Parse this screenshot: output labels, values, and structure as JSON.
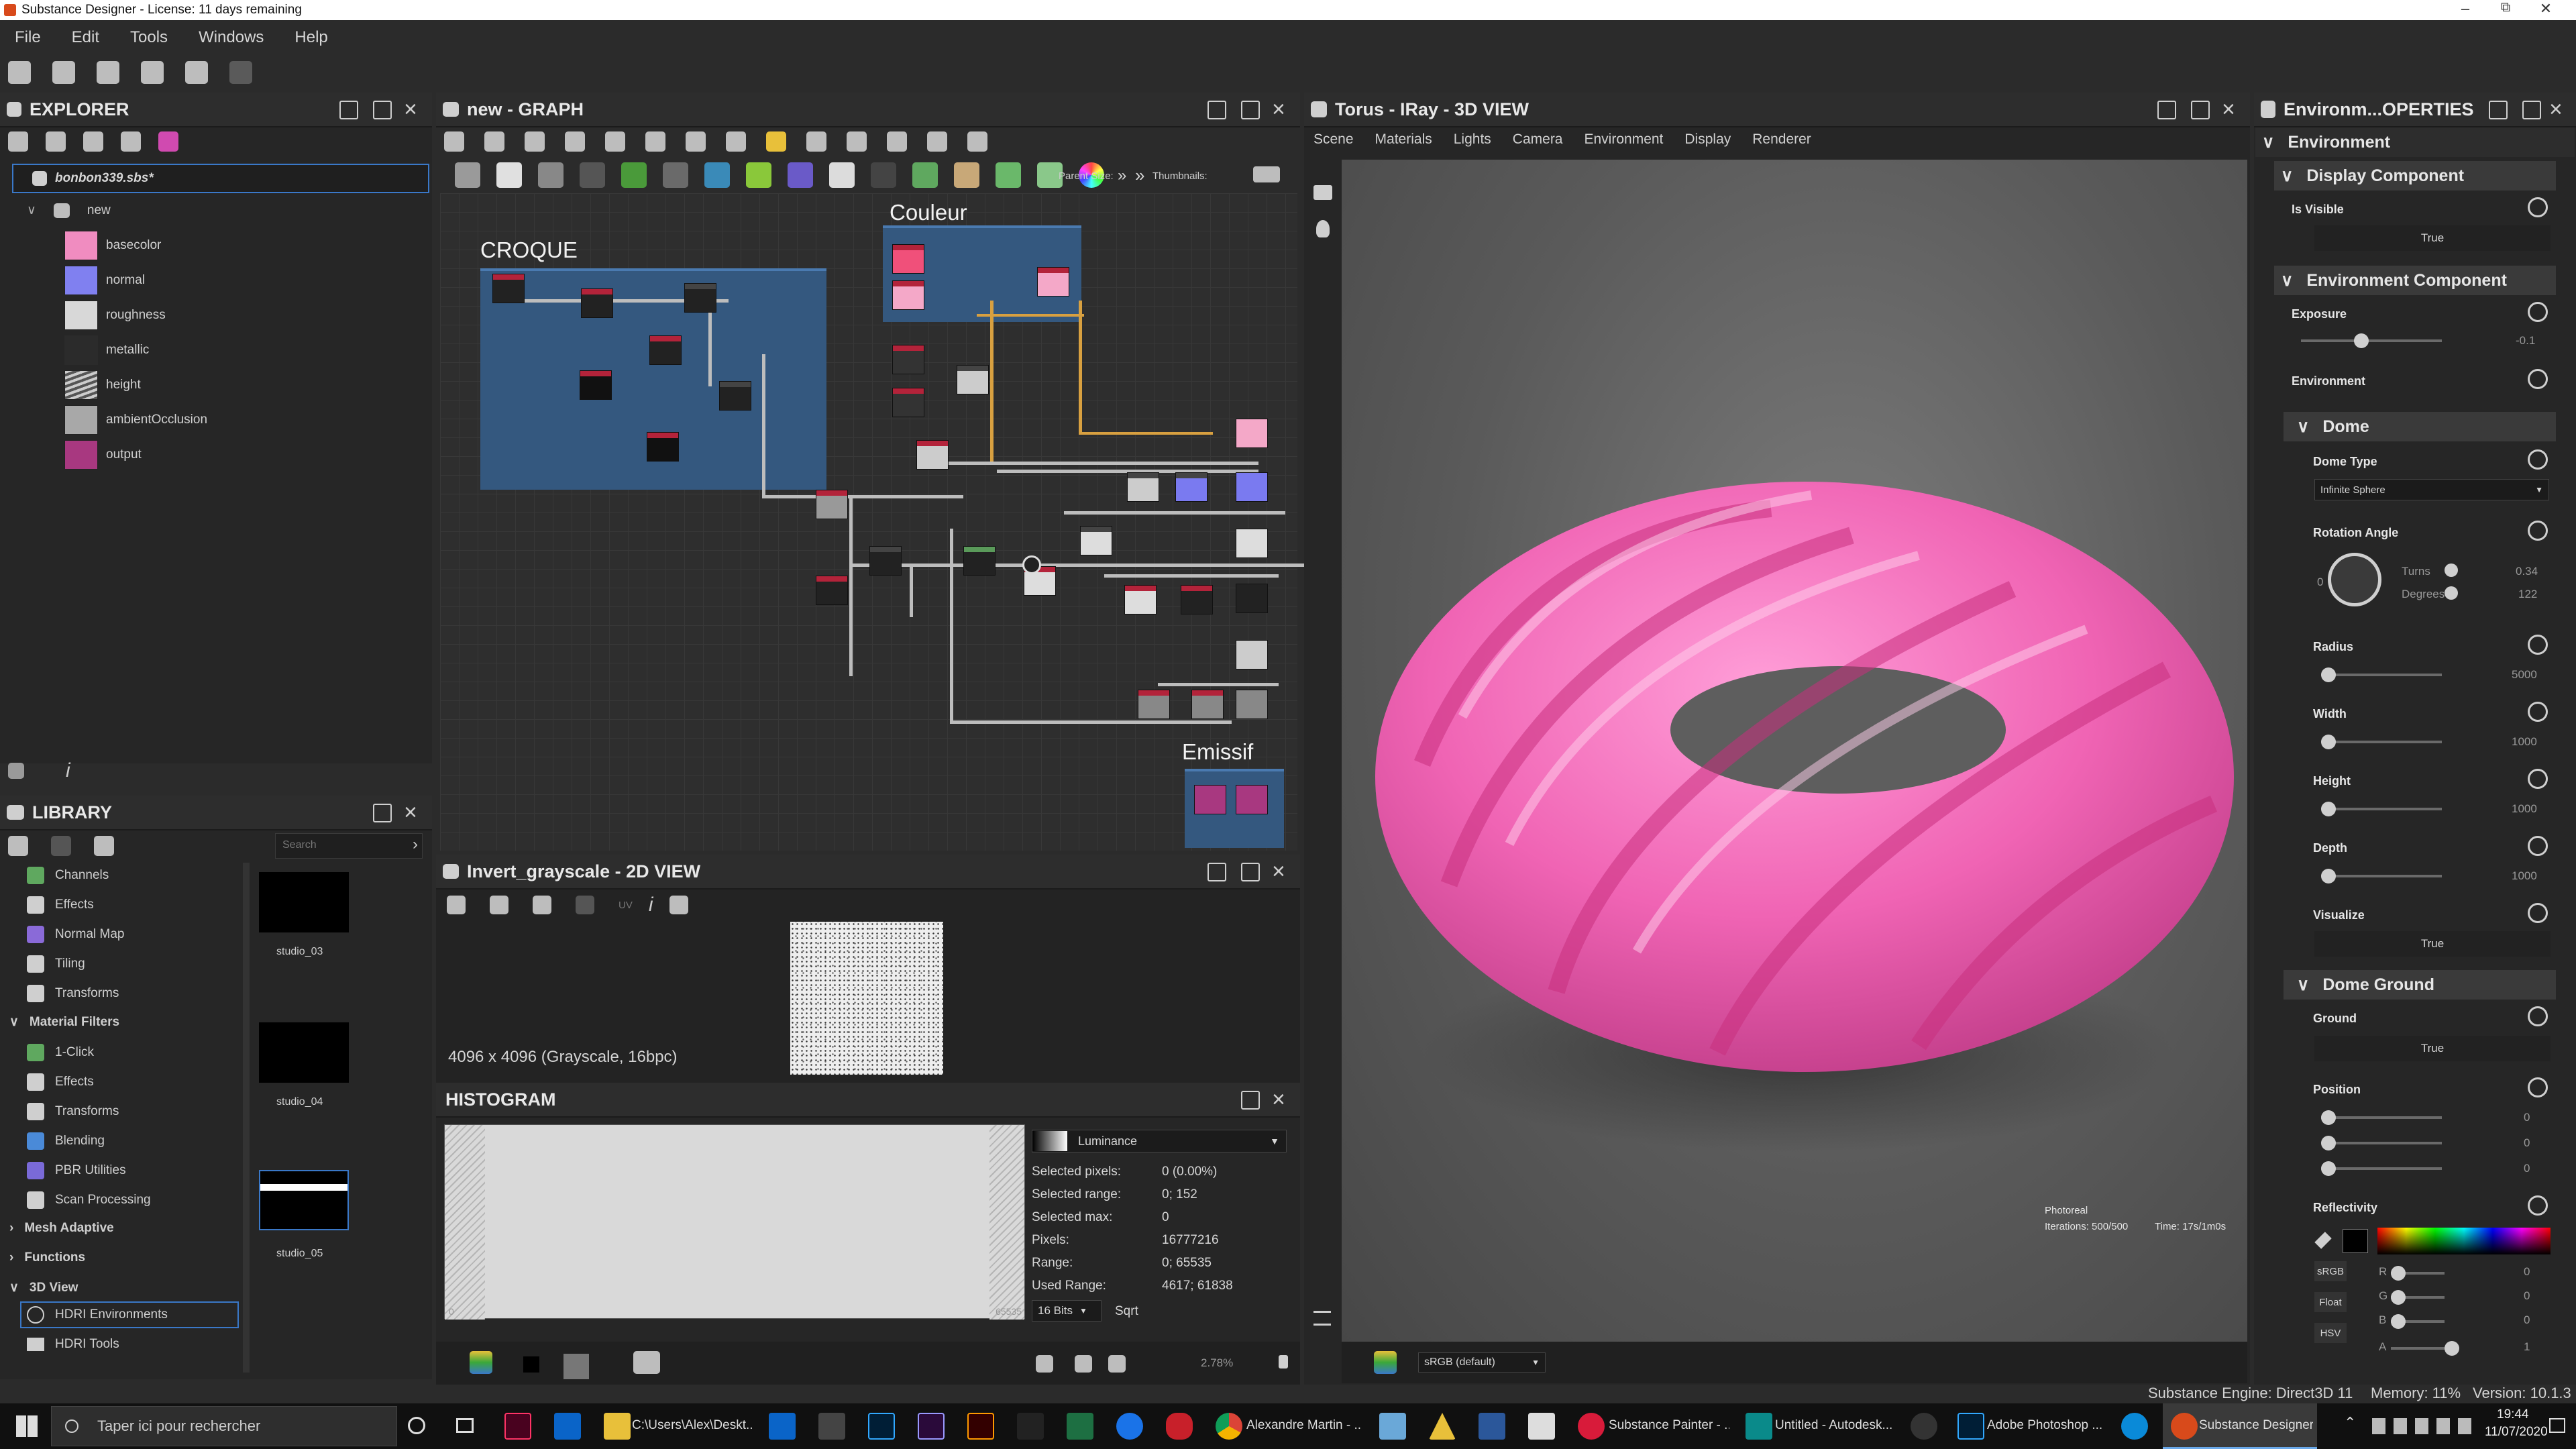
{
  "window": {
    "title": "Substance Designer - License: 11 days remaining"
  },
  "menu": [
    "File",
    "Edit",
    "Tools",
    "Windows",
    "Help"
  ],
  "explorer": {
    "title": "EXPLORER",
    "file": "bonbon339.sbs*",
    "graph": "new",
    "items": [
      {
        "label": "basecolor",
        "color": "#f08cc0"
      },
      {
        "label": "normal",
        "color": "#8080f0"
      },
      {
        "label": "roughness",
        "color": "#d8d8d8"
      },
      {
        "label": "metallic",
        "color": "#2b2b2b"
      },
      {
        "label": "height",
        "color": "#9a9a9a"
      },
      {
        "label": "ambientOcclusion",
        "color": "#a8a8a8"
      },
      {
        "label": "output",
        "color": "#a83880"
      }
    ]
  },
  "library": {
    "title": "LIBRARY",
    "search_placeholder": "Search",
    "items": [
      {
        "label": "Channels",
        "type": "item",
        "color": "#5fa85f"
      },
      {
        "label": "Effects",
        "type": "item",
        "color": "#cfcfcf"
      },
      {
        "label": "Normal Map",
        "type": "item",
        "color": "#8a6ad8"
      },
      {
        "label": "Tiling",
        "type": "item",
        "color": "#cfcfcf"
      },
      {
        "label": "Transforms",
        "type": "item",
        "color": "#cfcfcf"
      },
      {
        "label": "Material Filters",
        "type": "section"
      },
      {
        "label": "1-Click",
        "type": "item",
        "color": "#5fa85f"
      },
      {
        "label": "Effects",
        "type": "item",
        "color": "#cfcfcf"
      },
      {
        "label": "Transforms",
        "type": "item",
        "color": "#cfcfcf"
      },
      {
        "label": "Blending",
        "type": "item",
        "color": "#4a8ad8"
      },
      {
        "label": "PBR Utilities",
        "type": "item",
        "color": "#7a6ad8"
      },
      {
        "label": "Scan Processing",
        "type": "item",
        "color": "#cfcfcf"
      },
      {
        "label": "Mesh Adaptive",
        "type": "section-collapsed"
      },
      {
        "label": "Functions",
        "type": "section-collapsed"
      },
      {
        "label": "3D View",
        "type": "section"
      },
      {
        "label": "HDRI Environments",
        "type": "selected"
      },
      {
        "label": "HDRI Tools",
        "type": "item",
        "color": "#cfcfcf"
      }
    ],
    "thumbs": [
      "studio_03",
      "studio_04",
      "studio_05"
    ]
  },
  "graph": {
    "title": "new - GRAPH",
    "parent_size_label": "Parent Size:",
    "thumbnails_label": "Thumbnails:",
    "frames": [
      {
        "label": "CROQUE"
      },
      {
        "label": "Couleur"
      },
      {
        "label": "Emissif"
      }
    ]
  },
  "view2d": {
    "title": "Invert_grayscale - 2D VIEW",
    "info": "4096 x 4096 (Grayscale, 16bpc)",
    "uv_label": "UV"
  },
  "histogram": {
    "title": "HISTOGRAM",
    "mode": "Luminance",
    "stats": [
      {
        "label": "Selected pixels:",
        "value": "0 (0.00%)"
      },
      {
        "label": "Selected range:",
        "value": "0; 152"
      },
      {
        "label": "Selected max:",
        "value": "0"
      },
      {
        "label": "Pixels:",
        "value": "16777216"
      },
      {
        "label": "Range:",
        "value": "0; 65535"
      },
      {
        "label": "Used Range:",
        "value": "4617; 61838"
      }
    ],
    "axis_min": "0",
    "axis_max": "65535",
    "bits": "16 Bits",
    "scale": "Sqrt",
    "zoom": "2.78%"
  },
  "view3d": {
    "title": "Torus - IRay - 3D VIEW",
    "menu": [
      "Scene",
      "Materials",
      "Lights",
      "Camera",
      "Environment",
      "Display",
      "Renderer"
    ],
    "render_mode": "Photoreal",
    "iterations": "Iterations: 500/500",
    "time": "Time: 17s/1m0s",
    "colorspace": "sRGB (default)"
  },
  "properties": {
    "title": "Environm...OPERTIES",
    "section": "Environment",
    "display_component": "Display Component",
    "is_visible_label": "Is Visible",
    "is_visible": "True",
    "env_component": "Environment Component",
    "exposure_label": "Exposure",
    "exposure_value": "-0.1",
    "exposure_level": 0.43,
    "environment_label": "Environment",
    "dome": "Dome",
    "dome_type_label": "Dome Type",
    "dome_type": "Infinite Sphere",
    "rotation_label": "Rotation Angle",
    "rotation_zero": "0",
    "turns_label": "Turns",
    "turns_value": "0.34",
    "degrees_label": "Degrees",
    "degrees_value": "122",
    "radius_label": "Radius",
    "radius_value": "5000",
    "width_label": "Width",
    "width_value": "1000",
    "height_label": "Height",
    "height_value": "1000",
    "depth_label": "Depth",
    "depth_value": "1000",
    "visualize_label": "Visualize",
    "visualize": "True",
    "dome_ground": "Dome Ground",
    "ground_label": "Ground",
    "ground": "True",
    "position_label": "Position",
    "position_values": [
      "0",
      "0",
      "0"
    ],
    "reflectivity_label": "Reflectivity",
    "srgb": "sRGB",
    "float": "Float",
    "hsv": "HSV",
    "channels": [
      {
        "label": "R",
        "value": "0"
      },
      {
        "label": "G",
        "value": "0"
      },
      {
        "label": "B",
        "value": "0"
      },
      {
        "label": "A",
        "value": "1"
      }
    ]
  },
  "status": {
    "engine": "Substance Engine: Direct3D 11",
    "memory": "Memory: 11%",
    "version": "Version: 10.1.3"
  },
  "taskbar": {
    "search_placeholder": "Taper ici pour rechercher",
    "apps": [
      "C:\\Users\\Alex\\Deskt...",
      "Alexandre Martin - ...",
      "Substance Painter - ...",
      "Untitled - Autodesk...",
      "Adobe Photoshop ...",
      "Substance Designer..."
    ],
    "time": "19:44",
    "date": "11/07/2020"
  }
}
